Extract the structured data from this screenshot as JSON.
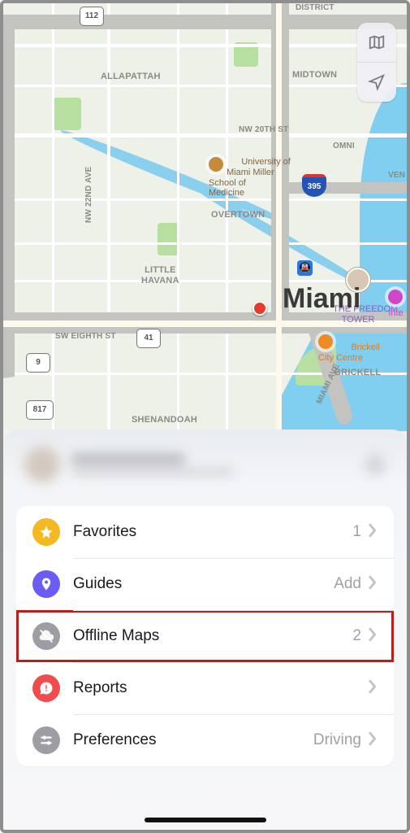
{
  "map": {
    "city_label": "Miami",
    "districts": {
      "allapattah": "ALLAPATTAH",
      "midtown": "MIDTOWN",
      "district": "DISTRICT",
      "overtown": "OVERTOWN",
      "little_havana": "LITTLE\nHAVANA",
      "shenandoah": "SHENANDOAH",
      "brickell": "BRICKELL",
      "omni": "OMNI",
      "ven": "VEN"
    },
    "streets": {
      "nw_20th": "NW 20TH ST",
      "sw_8th": "SW EIGHTH ST",
      "nw_22nd_ave": "NW 22ND AVE",
      "miami_ave": "MIAMI AVE"
    },
    "shields": {
      "us112": "112",
      "hwy41": "41",
      "hwy9": "9",
      "hwy817": "817",
      "i395": "395"
    },
    "poi": {
      "um": "University of\nMiami Miller\nSchool of\nMedicine",
      "freedom": "THE FREEDOM\nTOWER",
      "brickell_cc": "Brickell\nCity Centre",
      "inter": "Inte"
    }
  },
  "menu": {
    "items": [
      {
        "key": "favorites",
        "label": "Favorites",
        "meta": "1",
        "icon": "star"
      },
      {
        "key": "guides",
        "label": "Guides",
        "meta": "Add",
        "icon": "guides"
      },
      {
        "key": "offline",
        "label": "Offline Maps",
        "meta": "2",
        "icon": "offline",
        "highlight": true
      },
      {
        "key": "reports",
        "label": "Reports",
        "meta": "",
        "icon": "reports"
      },
      {
        "key": "prefs",
        "label": "Preferences",
        "meta": "Driving",
        "icon": "prefs"
      }
    ]
  }
}
